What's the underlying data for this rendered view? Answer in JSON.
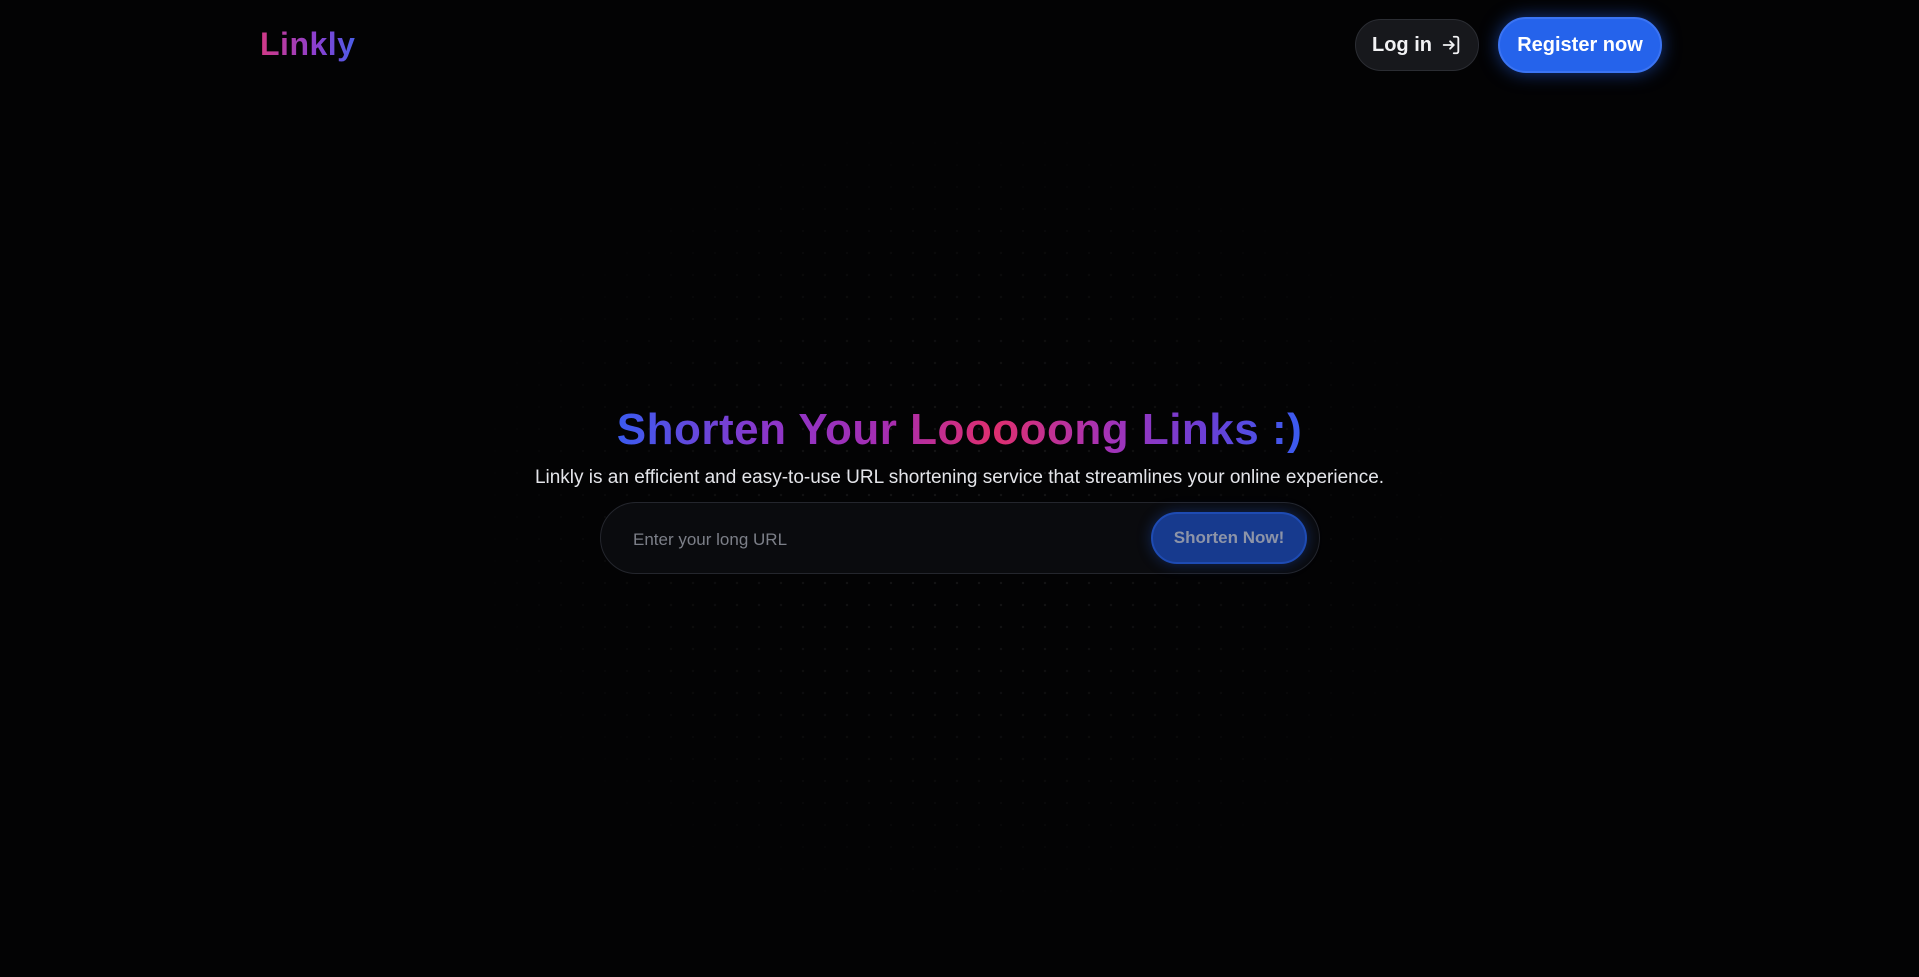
{
  "header": {
    "logo_text": "Linkly",
    "login_label": "Log in",
    "login_icon": "login-arrow-icon",
    "register_label": "Register now"
  },
  "hero": {
    "title": "Shorten Your Looooong Links :)",
    "subtitle": "Linkly is an efficient and easy-to-use URL shortening service that streamlines your online experience."
  },
  "form": {
    "input_placeholder": "Enter your long URL",
    "input_value": "",
    "submit_label": "Shorten Now!"
  },
  "colors": {
    "background": "#030304",
    "accent": "#2563eb",
    "gradient_pink": "#df2f6f",
    "gradient_purple": "#8c36c9",
    "gradient_blue": "#3b5bf0"
  }
}
